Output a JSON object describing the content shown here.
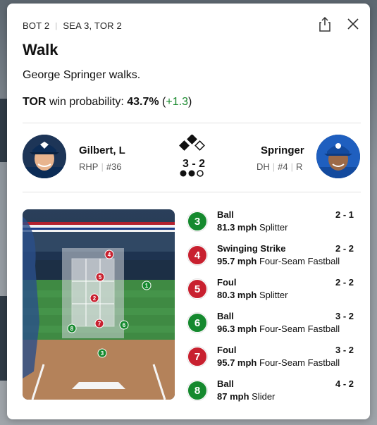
{
  "header": {
    "inning": "BOT 2",
    "score": "SEA 3, TOR 2"
  },
  "play": {
    "title": "Walk",
    "description": "George Springer walks.",
    "wp_team": "TOR",
    "wp_label": "win probability:",
    "wp_value": "43.7%",
    "wp_open": "(",
    "wp_delta": "+1.3",
    "wp_close": ")"
  },
  "pitcher": {
    "name": "Gilbert, L",
    "hand": "RHP",
    "number": "#36"
  },
  "batter": {
    "name": "Springer",
    "position": "DH",
    "number": "#4",
    "bats": "R"
  },
  "situation": {
    "count": "3 - 2",
    "runner_on_first": false,
    "runner_on_second": true,
    "runner_on_third": false,
    "outs": 2
  },
  "colors": {
    "ball": "#15892e",
    "strike": "#c8202f",
    "green_text": "#1a8a2e"
  },
  "pitches": [
    {
      "num": "3",
      "result": "Ball",
      "count": "2 - 1",
      "speed": "81.3 mph",
      "type": "Splitter",
      "kind": "ball"
    },
    {
      "num": "4",
      "result": "Swinging Strike",
      "count": "2 - 2",
      "speed": "95.7 mph",
      "type": "Four-Seam Fastball",
      "kind": "strike"
    },
    {
      "num": "5",
      "result": "Foul",
      "count": "2 - 2",
      "speed": "80.3 mph",
      "type": "Splitter",
      "kind": "strike"
    },
    {
      "num": "6",
      "result": "Ball",
      "count": "3 - 2",
      "speed": "96.3 mph",
      "type": "Four-Seam Fastball",
      "kind": "ball"
    },
    {
      "num": "7",
      "result": "Foul",
      "count": "3 - 2",
      "speed": "95.7 mph",
      "type": "Four-Seam Fastball",
      "kind": "strike"
    },
    {
      "num": "8",
      "result": "Ball",
      "count": "4 - 2",
      "speed": "87 mph",
      "type": "Slider",
      "kind": "ball"
    }
  ],
  "zone_markers": [
    {
      "num": "1",
      "kind": "ball"
    },
    {
      "num": "2",
      "kind": "strike"
    },
    {
      "num": "3",
      "kind": "ball"
    },
    {
      "num": "4",
      "kind": "strike"
    },
    {
      "num": "5",
      "kind": "strike"
    },
    {
      "num": "6",
      "kind": "ball"
    },
    {
      "num": "7",
      "kind": "strike"
    },
    {
      "num": "8",
      "kind": "ball"
    }
  ]
}
